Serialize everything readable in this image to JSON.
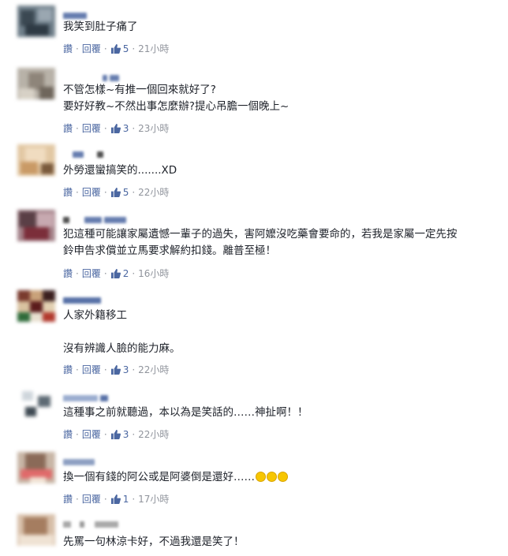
{
  "colors": {
    "link": "#4b67a1",
    "meta": "#90949c",
    "text": "#1d2129"
  },
  "icons": {
    "like": "thumbs-up-icon",
    "emoji": "rofl-emoji-icon"
  },
  "comments": [
    {
      "text_lines": [
        "我笑到肚子痛了"
      ],
      "read": "讚",
      "reply": "回覆",
      "likes": "5",
      "time": "21小時"
    },
    {
      "text_lines": [
        "不管怎樣~有推一個回來就好了?",
        "要好好教~不然出事怎麼辦?提心吊膽一個晚上~"
      ],
      "read": "讚",
      "reply": "回覆",
      "likes": "3",
      "time": "23小時"
    },
    {
      "text_lines": [
        "外勞還蠻搞笑的.......XD"
      ],
      "read": "讚",
      "reply": "回覆",
      "likes": "5",
      "time": "22小時"
    },
    {
      "text_lines": [
        "犯這種可能讓家屬遺憾一輩子的過失，害阿嬤沒吃藥會要命的，若我是家屬一定先按",
        "鈴申告求償並立馬要求解約扣錢。離普至極！"
      ],
      "read": "讚",
      "reply": "回覆",
      "likes": "2",
      "time": "16小時"
    },
    {
      "text_lines": [
        "人家外籍移工",
        "",
        "沒有辨識人臉的能力麻。"
      ],
      "read": "讚",
      "reply": "回覆",
      "likes": "3",
      "time": "22小時"
    },
    {
      "text_lines": [
        "這種事之前就聽過，本以為是笑話的……神扯啊！！"
      ],
      "read": "讚",
      "reply": "回覆",
      "likes": "3",
      "time": "22小時"
    },
    {
      "text_lines": [
        "換一個有錢的阿公或是阿婆倒是還好……"
      ],
      "emoji_count": 3,
      "read": "讚",
      "reply": "回覆",
      "likes": "1",
      "time": "17小時"
    },
    {
      "text_lines": [
        "先罵一句林涼卡好，不過我還是笑了！"
      ]
    }
  ]
}
